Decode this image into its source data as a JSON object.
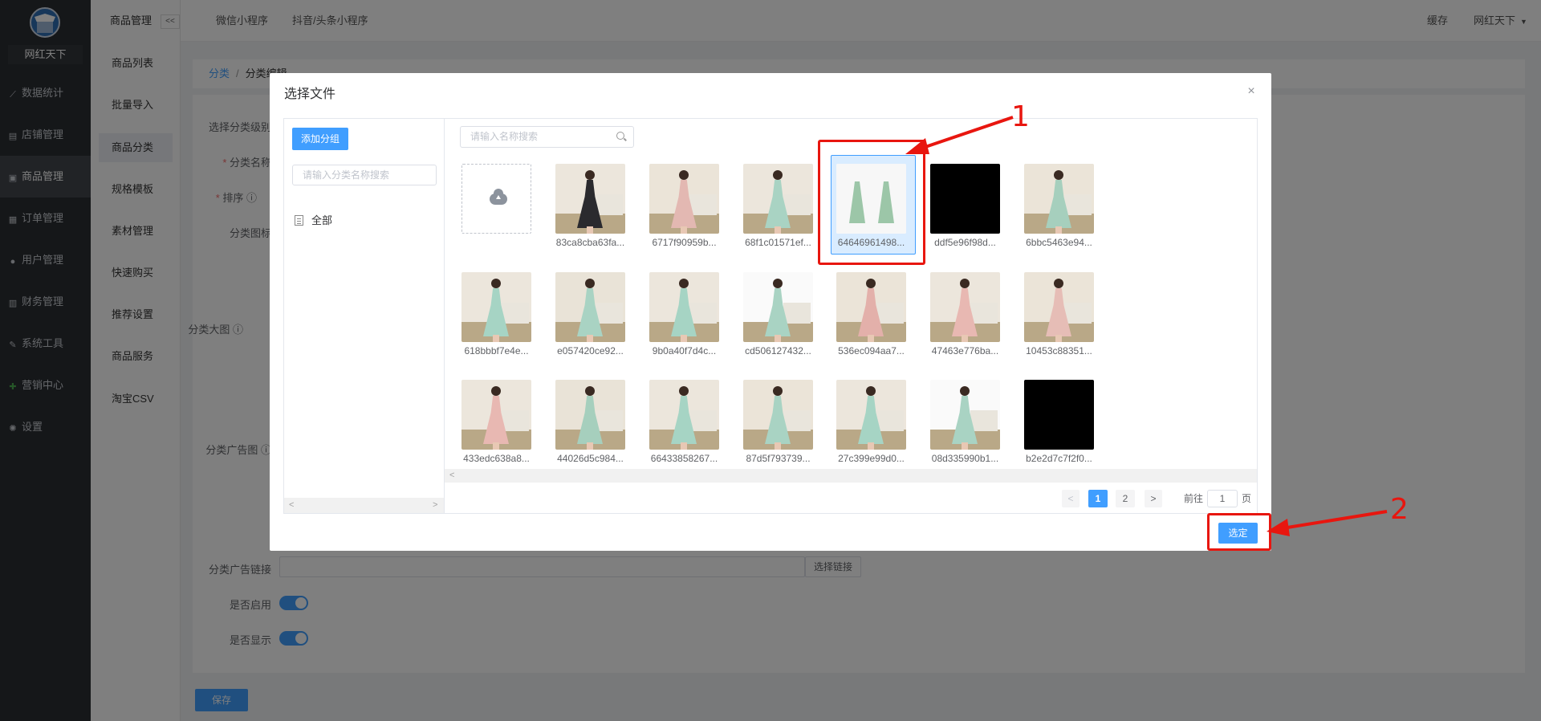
{
  "sidebar": {
    "logo_name": "网红天下",
    "items": [
      {
        "label": "数据统计",
        "icon": "chart-line-icon"
      },
      {
        "label": "店铺管理",
        "icon": "store-icon"
      },
      {
        "label": "商品管理",
        "icon": "goods-icon"
      },
      {
        "label": "订单管理",
        "icon": "order-icon"
      },
      {
        "label": "用户管理",
        "icon": "user-icon"
      },
      {
        "label": "财务管理",
        "icon": "finance-icon"
      },
      {
        "label": "系统工具",
        "icon": "wrench-icon"
      },
      {
        "label": "营销中心",
        "icon": "marketing-icon"
      },
      {
        "label": "设置",
        "icon": "settings-gear-icon"
      }
    ],
    "active_index": 2
  },
  "sub_sidebar": {
    "title": "商品管理",
    "collapse": "<<",
    "items": [
      "商品列表",
      "批量导入",
      "商品分类",
      "规格模板",
      "素材管理",
      "快速购买",
      "推荐设置",
      "商品服务",
      "淘宝CSV"
    ],
    "active_index": 2
  },
  "topbar": {
    "links": [
      "微信小程序",
      "抖音/头条小程序"
    ],
    "cache": "缓存",
    "user": "网红天下"
  },
  "breadcrumb": {
    "root": "分类",
    "current": "分类编辑"
  },
  "form": {
    "level_label": "选择分类级别",
    "name_label": "分类名称",
    "sort_label": "排序",
    "icon_label": "分类图标",
    "big_image_label": "分类大图",
    "ad_image_label": "分类广告图",
    "ad_link_label": "分类广告链接",
    "ad_link_button": "选择链接",
    "enabled_label": "是否启用",
    "display_label": "是否显示",
    "save_button": "保存"
  },
  "dialog": {
    "title": "选择文件",
    "add_group_button": "添加分组",
    "group_search_placeholder": "请输入分类名称搜索",
    "group_all": "全部",
    "file_search_placeholder": "请输入名称搜索",
    "files": [
      {
        "name": "83ca8cba63fa...",
        "dress": "#2a2a2e",
        "bg": "#ece6dc"
      },
      {
        "name": "6717f90959b...",
        "dress": "#e3b8b2",
        "bg": "#ebe4d8"
      },
      {
        "name": "68f1c01571ef...",
        "dress": "#a9d3c3",
        "bg": "#ece6dc"
      },
      {
        "name": "64646961498...",
        "dress": "#9cc6a8",
        "bg": "#f4f4f4",
        "selected": true
      },
      {
        "name": "ddf5e96f98d...",
        "dress": "#000000",
        "bg": "#000000",
        "blank": true
      },
      {
        "name": "6bbc5463e94...",
        "dress": "#a6cfbd",
        "bg": "#ebe4d8"
      },
      {
        "name": "618bbbf7e4e...",
        "dress": "#a6d4c4",
        "bg": "#ece6dc"
      },
      {
        "name": "e057420ce92...",
        "dress": "#a9d3c3",
        "bg": "#e9e3d7"
      },
      {
        "name": "9b0a40f7d4c...",
        "dress": "#a6d4c4",
        "bg": "#ece6dc"
      },
      {
        "name": "cd506127432...",
        "dress": "#a9d3c3",
        "bg": "#fafafa"
      },
      {
        "name": "536ec094aa7...",
        "dress": "#e3b0aa",
        "bg": "#ebe4d8"
      },
      {
        "name": "47463e776ba...",
        "dress": "#e8b8b2",
        "bg": "#ece6dc"
      },
      {
        "name": "10453c88351...",
        "dress": "#e6bdb6",
        "bg": "#ebe4d8"
      },
      {
        "name": "433edc638a8...",
        "dress": "#e8b8b2",
        "bg": "#ece6dc"
      },
      {
        "name": "44026d5c984...",
        "dress": "#a6cfbd",
        "bg": "#e9e3d7"
      },
      {
        "name": "66433858267...",
        "dress": "#a6d4c4",
        "bg": "#ece6dc"
      },
      {
        "name": "87d5f793739...",
        "dress": "#a9d3c3",
        "bg": "#ebe4d8"
      },
      {
        "name": "27c399e99d0...",
        "dress": "#a6d4c4",
        "bg": "#ece6dc"
      },
      {
        "name": "08d335990b1...",
        "dress": "#a9d3c3",
        "bg": "#fafafa"
      },
      {
        "name": "b2e2d7c7f2f0...",
        "dress": "#000000",
        "bg": "#000000",
        "blank": true
      }
    ],
    "pagination": {
      "prev": "<",
      "pages": [
        "1",
        "2"
      ],
      "current": "1",
      "next": ">",
      "goto_label": "前往",
      "goto_value": "1",
      "page_unit": "页"
    },
    "confirm_button": "选定"
  },
  "annotations": [
    "1",
    "2"
  ],
  "colors": {
    "accent": "#409eff",
    "sidebar": "#2b2e33",
    "annotation_red": "#e8160f"
  }
}
